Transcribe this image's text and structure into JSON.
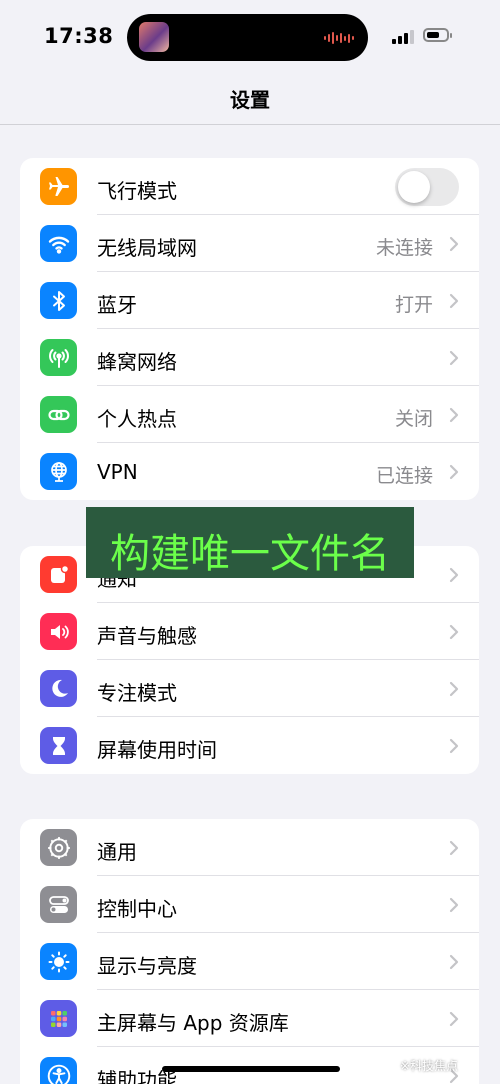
{
  "status": {
    "time": "17:38"
  },
  "nav": {
    "title": "设置"
  },
  "groups": [
    {
      "rows": [
        {
          "label": "飞行模式",
          "icon": "airplane-icon",
          "color": "#ff9500",
          "toggle": false
        },
        {
          "label": "无线局域网",
          "value": "未连接",
          "icon": "wifi-icon",
          "color": "#0a84ff"
        },
        {
          "label": "蓝牙",
          "value": "打开",
          "icon": "bluetooth-icon",
          "color": "#0a84ff"
        },
        {
          "label": "蜂窝网络",
          "icon": "cellular-antenna-icon",
          "color": "#34c759"
        },
        {
          "label": "个人热点",
          "value": "关闭",
          "icon": "hotspot-link-icon",
          "color": "#34c759"
        },
        {
          "label": "VPN",
          "value": "已连接",
          "icon": "vpn-globe-icon",
          "color": "#0a84ff"
        }
      ]
    },
    {
      "rows": [
        {
          "label": "通知",
          "icon": "notification-bell-icon",
          "color": "#ff3b30"
        },
        {
          "label": "声音与触感",
          "icon": "speaker-icon",
          "color": "#ff2d55"
        },
        {
          "label": "专注模式",
          "icon": "moon-icon",
          "color": "#5e5ce6"
        },
        {
          "label": "屏幕使用时间",
          "icon": "hourglass-icon",
          "color": "#5e5ce6"
        }
      ]
    },
    {
      "rows": [
        {
          "label": "通用",
          "icon": "gear-icon",
          "color": "#8e8e93"
        },
        {
          "label": "控制中心",
          "icon": "switches-icon",
          "color": "#8e8e93"
        },
        {
          "label": "显示与亮度",
          "icon": "sun-icon",
          "color": "#0a84ff"
        },
        {
          "label": "主屏幕与 App 资源库",
          "icon": "app-grid-icon",
          "color": "#5e5ce6"
        },
        {
          "label": "辅助功能",
          "icon": "accessibility-icon",
          "color": "#0a84ff"
        }
      ]
    }
  ],
  "overlay": {
    "text": "构建唯一文件名"
  },
  "watermark": {
    "text": "※科技焦点"
  }
}
